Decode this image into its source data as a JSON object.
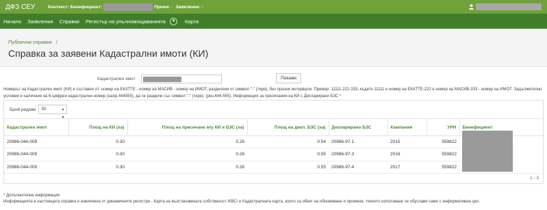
{
  "topbar": {
    "brand": "ДФЗ СЕУ",
    "context_label": "Контекст:",
    "beneficiary_label": "Бенефициент:",
    "reception_label": "Прием: -",
    "application_label": "Заявление: -"
  },
  "nav": {
    "items": [
      "Начало",
      "Заявления",
      "Справки",
      "Регистър на упълномощаванията",
      "Карта"
    ]
  },
  "header": {
    "breadcrumb": "Публични справки",
    "breadcrumb_sep": "/",
    "title": "Справка за заявени Кадастрални имоти (КИ)"
  },
  "search": {
    "label": "Кадастрален имот",
    "button": "Покажи"
  },
  "info_text": "Номерът на Кадастрален имот (КИ) е съставен от: номер на ЕКАТТЕ - номер на МАСИВ - номер на ИМОТ, разделени от символ \"-\" (тире), без празни интервали. Пример: 11111-222-333, където 11111 е номер на ЕКАТТЕ-222 е номер на МАСИВ-333 - номер на ИМОТ. Задължително условие е наличния на 6-цифрен кадастрален номер (напр.444555), да се раздели със символ \"-\" (тире). (рез.444-555). Информация за пресичания на КИ с Декларирани БЗС *",
  "table": {
    "rows_label": "Брой редове",
    "rows_value": "50",
    "columns": [
      "Кадастрален имот",
      "Площ на КИ (ха)",
      "Площ на пресичане м/у КИ и БЗС (ха)",
      "Площ на декл. БЗС (ха)",
      "Декларирано БЗС",
      "Кампания",
      "УРН",
      "Бенефициент"
    ],
    "rows": [
      [
        "20986-044-009",
        "0.30",
        "0.28",
        "0.54",
        "20986-97-1",
        "2015",
        "559822"
      ],
      [
        "20986-044-009",
        "0.30",
        "0.28",
        "0.55",
        "20986-97-3",
        "2016",
        "559822"
      ],
      [
        "20986-044-009",
        "0.30",
        "0.28",
        "0.55",
        "20986-97-4",
        "2017",
        "559822"
      ]
    ],
    "pager": "1 - 3"
  },
  "footer": {
    "line1": "* Допълнителна информация",
    "line2": "Информацията в настоящата справка е извлечена от динамичните регистри - Карта на възстановената собственост /КВС/ и Кадастралната карта, които са обект на обновяване и промени, тяхното използване се обуславя само с информативна цел."
  },
  "colors": {
    "topbar": "#6fa23a",
    "navbar": "#3f7f2a",
    "accent_text": "#4c8a2c",
    "redaction": "#9a9a9a"
  }
}
